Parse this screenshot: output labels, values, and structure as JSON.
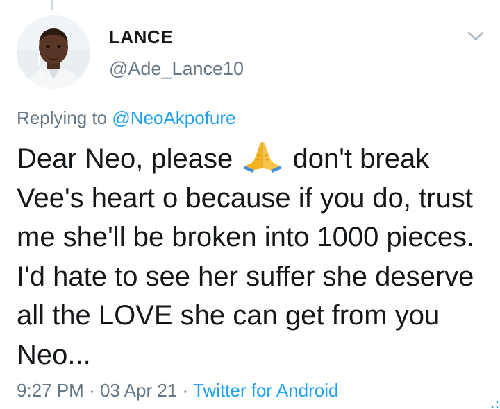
{
  "tweet": {
    "display_name": "LANCE",
    "handle": "@Ade_Lance10",
    "reply_prefix": "Replying to",
    "reply_to": "@NeoAkpofure",
    "text_before_emoji": "Dear Neo, please",
    "emoji_icon": "folded-hands-emoji",
    "text_after_emoji": "don't break Vee's heart o because if you do, trust me she'll be broken into 1000 pieces. I'd hate to see her suffer she deserve all the LOVE she can get from you Neo...",
    "time": "9:27 PM",
    "separator": "·",
    "date": "03 Apr 21",
    "source": "Twitter for Android"
  },
  "colors": {
    "text": "#14171a",
    "secondary": "#657786",
    "link": "#1da1f2",
    "emoji": "#f5b323"
  }
}
